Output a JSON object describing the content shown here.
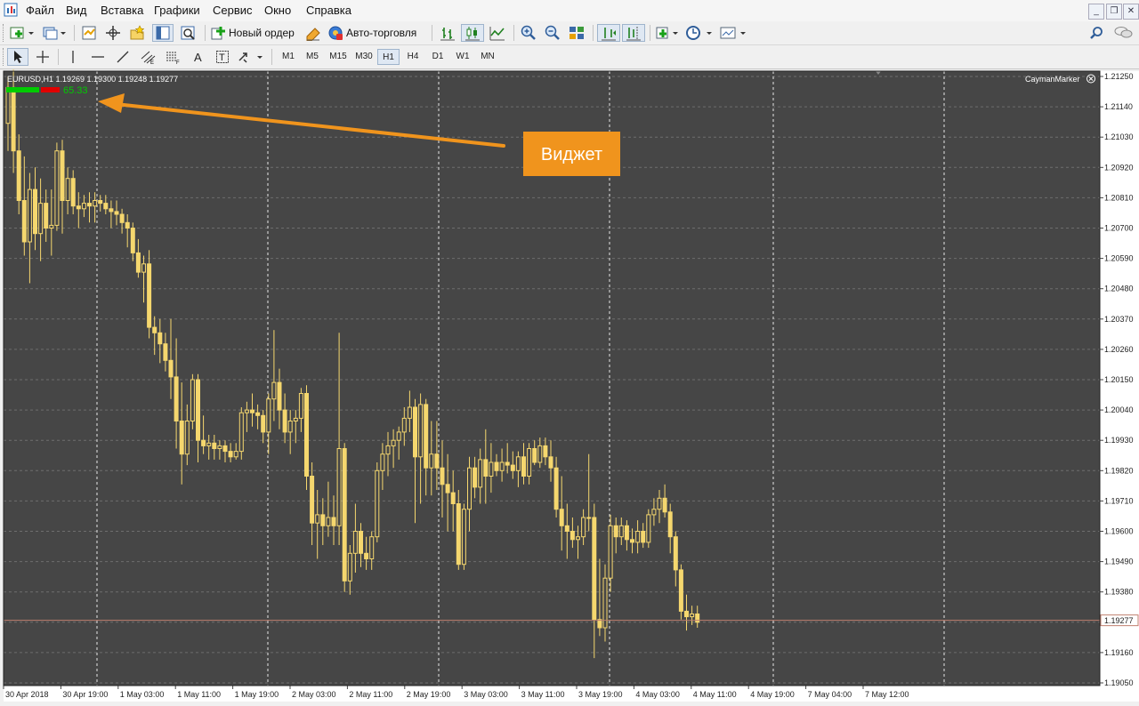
{
  "menu": {
    "items": [
      "Файл",
      "Вид",
      "Вставка",
      "Графики",
      "Сервис",
      "Окно",
      "Справка"
    ]
  },
  "toolbar": {
    "new_order_label": "Новый ордер",
    "auto_trading_label": "Авто-торговля"
  },
  "timeframes": [
    "M1",
    "M5",
    "M15",
    "M30",
    "H1",
    "H4",
    "D1",
    "W1",
    "MN"
  ],
  "active_timeframe": "H1",
  "chart": {
    "header": "EURUSD,H1  1.19269 1.19300 1.19248 1.19277",
    "indicator_name": "CaymanMarker",
    "widget_value": "65.33",
    "annotation": "Виджет",
    "current_price_label": "1.19277",
    "colors": {
      "background": "#464646",
      "candle": "#f5d76e",
      "grid": "#6e6e6e",
      "annotation": "#f0941d",
      "price_line": "#c08070",
      "widget_green": "#00cc00",
      "widget_red": "#e00000"
    }
  },
  "chart_data": {
    "type": "candlestick",
    "symbol": "EURUSD",
    "timeframe": "H1",
    "y_ticks": [
      "1.21250",
      "1.21140",
      "1.21030",
      "1.20920",
      "1.20810",
      "1.20700",
      "1.20590",
      "1.20480",
      "1.20370",
      "1.20260",
      "1.20150",
      "1.20040",
      "1.19930",
      "1.19820",
      "1.19710",
      "1.19600",
      "1.19490",
      "1.19380",
      "1.19270",
      "1.19160",
      "1.19050"
    ],
    "x_ticks": [
      "30 Apr 2018",
      "30 Apr 19:00",
      "1 May 03:00",
      "1 May 11:00",
      "1 May 19:00",
      "2 May 03:00",
      "2 May 11:00",
      "2 May 19:00",
      "3 May 03:00",
      "3 May 11:00",
      "3 May 19:00",
      "4 May 03:00",
      "4 May 11:00",
      "4 May 19:00",
      "7 May 04:00",
      "7 May 12:00"
    ],
    "ylim": [
      1.1905,
      1.2125
    ],
    "last_price": 1.19277,
    "candles": [
      [
        1.2108,
        1.2125,
        1.2098,
        1.2121
      ],
      [
        1.2121,
        1.2128,
        1.209,
        1.2098
      ],
      [
        1.2098,
        1.2104,
        1.2075,
        1.208
      ],
      [
        1.208,
        1.2096,
        1.206,
        1.2065
      ],
      [
        1.2065,
        1.209,
        1.205,
        1.2084
      ],
      [
        1.2084,
        1.2092,
        1.2062,
        1.2068
      ],
      [
        1.2068,
        1.2088,
        1.2058,
        1.2079
      ],
      [
        1.2079,
        1.2084,
        1.2065,
        1.207
      ],
      [
        1.207,
        1.2084,
        1.206,
        1.2071
      ],
      [
        1.2071,
        1.2101,
        1.2069,
        1.2098
      ],
      [
        1.2098,
        1.2102,
        1.2068,
        1.208
      ],
      [
        1.208,
        1.2092,
        1.2075,
        1.2088
      ],
      [
        1.2088,
        1.2091,
        1.2075,
        1.2078
      ],
      [
        1.2078,
        1.2083,
        1.207,
        1.2077
      ],
      [
        1.2077,
        1.2082,
        1.2074,
        1.2079
      ],
      [
        1.2079,
        1.2083,
        1.2072,
        1.2078
      ],
      [
        1.2078,
        1.2083,
        1.2072,
        1.208
      ],
      [
        1.208,
        1.2082,
        1.2076,
        1.2079
      ],
      [
        1.2079,
        1.2082,
        1.2075,
        1.2077
      ],
      [
        1.2077,
        1.208,
        1.207,
        1.2076
      ],
      [
        1.2076,
        1.208,
        1.2071,
        1.2075
      ],
      [
        1.2075,
        1.2077,
        1.2068,
        1.2072
      ],
      [
        1.2072,
        1.2075,
        1.2063,
        1.207
      ],
      [
        1.207,
        1.2072,
        1.2058,
        1.2061
      ],
      [
        1.2061,
        1.2066,
        1.2052,
        1.2054
      ],
      [
        1.2054,
        1.206,
        1.2043,
        1.2057
      ],
      [
        1.2057,
        1.2062,
        1.203,
        1.2034
      ],
      [
        1.2034,
        1.2038,
        1.2024,
        1.2032
      ],
      [
        1.2032,
        1.2037,
        1.2021,
        1.2028
      ],
      [
        1.2028,
        1.2032,
        1.2018,
        1.2022
      ],
      [
        1.2022,
        1.2037,
        1.2008,
        1.2016
      ],
      [
        1.2016,
        1.203,
        1.199,
        1.2
      ],
      [
        1.2,
        1.2014,
        1.1977,
        1.1988
      ],
      [
        1.1988,
        1.2006,
        1.1984,
        1.2
      ],
      [
        1.2,
        1.2017,
        1.1997,
        1.2015
      ],
      [
        1.2015,
        1.2017,
        1.1985,
        1.1993
      ],
      [
        1.1993,
        1.2002,
        1.1988,
        1.1991
      ],
      [
        1.1991,
        1.1995,
        1.1986,
        1.1992
      ],
      [
        1.1992,
        1.1995,
        1.1986,
        1.199
      ],
      [
        1.199,
        1.1993,
        1.1986,
        1.1991
      ],
      [
        1.1991,
        1.1993,
        1.1985,
        1.1989
      ],
      [
        1.1989,
        1.1992,
        1.1985,
        1.1987
      ],
      [
        1.1987,
        1.1992,
        1.1986,
        1.1989
      ],
      [
        1.1989,
        1.2005,
        1.1986,
        1.2003
      ],
      [
        1.2003,
        1.2007,
        1.1996,
        1.2004
      ],
      [
        1.2004,
        1.201,
        1.1998,
        1.2003
      ],
      [
        1.2003,
        1.2006,
        1.1997,
        1.2002
      ],
      [
        1.2002,
        1.2004,
        1.1992,
        1.1996
      ],
      [
        1.1996,
        1.201,
        1.1988,
        1.2008
      ],
      [
        1.2008,
        1.2033,
        1.2,
        1.2014
      ],
      [
        1.2014,
        1.2019,
        1.1997,
        1.2004
      ],
      [
        1.2004,
        1.201,
        1.1992,
        1.1996
      ],
      [
        1.1996,
        1.2004,
        1.1988,
        1.2
      ],
      [
        1.2,
        1.2004,
        1.1992,
        1.2001
      ],
      [
        1.2001,
        1.2012,
        1.1996,
        1.201
      ],
      [
        1.201,
        1.2013,
        1.1975,
        1.198
      ],
      [
        1.198,
        1.1985,
        1.1955,
        1.1963
      ],
      [
        1.1963,
        1.1975,
        1.195,
        1.1966
      ],
      [
        1.1966,
        1.1972,
        1.1955,
        1.1962
      ],
      [
        1.1962,
        1.1978,
        1.1958,
        1.1965
      ],
      [
        1.1965,
        1.1973,
        1.1955,
        1.1962
      ],
      [
        1.1962,
        1.2032,
        1.1955,
        1.199
      ],
      [
        1.199,
        1.1992,
        1.1938,
        1.1942
      ],
      [
        1.1942,
        1.1955,
        1.1937,
        1.1952
      ],
      [
        1.1952,
        1.197,
        1.1945,
        1.196
      ],
      [
        1.196,
        1.1963,
        1.1947,
        1.1952
      ],
      [
        1.1952,
        1.1958,
        1.1946,
        1.195
      ],
      [
        1.195,
        1.196,
        1.1946,
        1.1958
      ],
      [
        1.1958,
        1.1985,
        1.1956,
        1.1982
      ],
      [
        1.1982,
        1.1992,
        1.1975,
        1.1988
      ],
      [
        1.1988,
        1.1996,
        1.198,
        1.1991
      ],
      [
        1.1991,
        1.1997,
        1.1983,
        1.1993
      ],
      [
        1.1993,
        1.1998,
        1.1986,
        1.1996
      ],
      [
        1.1996,
        1.2005,
        1.1991,
        1.2001
      ],
      [
        1.2001,
        1.2011,
        1.1996,
        1.2005
      ],
      [
        1.2005,
        1.2008,
        1.1963,
        1.1987
      ],
      [
        1.1987,
        1.201,
        1.197,
        1.2006
      ],
      [
        1.2006,
        1.2008,
        1.1973,
        1.1983
      ],
      [
        1.1983,
        1.2,
        1.1973,
        1.1988
      ],
      [
        1.1988,
        1.2,
        1.1975,
        1.1983
      ],
      [
        1.1983,
        1.1993,
        1.1965,
        1.1977
      ],
      [
        1.1977,
        1.1988,
        1.196,
        1.1974
      ],
      [
        1.1974,
        1.1982,
        1.196,
        1.197
      ],
      [
        1.197,
        1.1975,
        1.1946,
        1.1948
      ],
      [
        1.1948,
        1.197,
        1.1946,
        1.1968
      ],
      [
        1.1968,
        1.1987,
        1.196,
        1.1983
      ],
      [
        1.1983,
        1.1987,
        1.1972,
        1.1976
      ],
      [
        1.1976,
        1.199,
        1.197,
        1.1986
      ],
      [
        1.1986,
        1.1997,
        1.197,
        1.198
      ],
      [
        1.198,
        1.1992,
        1.1974,
        1.1985
      ],
      [
        1.1985,
        1.1988,
        1.198,
        1.1982
      ],
      [
        1.1982,
        1.199,
        1.1978,
        1.1985
      ],
      [
        1.1985,
        1.1992,
        1.1981,
        1.1984
      ],
      [
        1.1984,
        1.1989,
        1.1979,
        1.1982
      ],
      [
        1.1982,
        1.1989,
        1.1976,
        1.1987
      ],
      [
        1.1987,
        1.1992,
        1.1977,
        1.198
      ],
      [
        1.198,
        1.1992,
        1.1977,
        1.199
      ],
      [
        1.199,
        1.1993,
        1.1984,
        1.1985
      ],
      [
        1.1985,
        1.1994,
        1.1983,
        1.1991
      ],
      [
        1.1991,
        1.1994,
        1.1984,
        1.1987
      ],
      [
        1.1987,
        1.1993,
        1.1978,
        1.1983
      ],
      [
        1.1983,
        1.1987,
        1.1965,
        1.1968
      ],
      [
        1.1968,
        1.198,
        1.1953,
        1.1962
      ],
      [
        1.1962,
        1.197,
        1.195,
        1.196
      ],
      [
        1.196,
        1.1965,
        1.1954,
        1.1957
      ],
      [
        1.1957,
        1.1962,
        1.195,
        1.1958
      ],
      [
        1.1958,
        1.1968,
        1.1955,
        1.1965
      ],
      [
        1.1965,
        1.1988,
        1.196,
        1.1965
      ],
      [
        1.1965,
        1.197,
        1.1914,
        1.1928
      ],
      [
        1.1928,
        1.195,
        1.1922,
        1.1925
      ],
      [
        1.1925,
        1.1948,
        1.192,
        1.1943
      ],
      [
        1.1943,
        1.1966,
        1.1938,
        1.1962
      ],
      [
        1.1962,
        1.1965,
        1.1952,
        1.1958
      ],
      [
        1.1958,
        1.1965,
        1.1955,
        1.1962
      ],
      [
        1.1962,
        1.1964,
        1.1953,
        1.1957
      ],
      [
        1.1957,
        1.1961,
        1.1952,
        1.1956
      ],
      [
        1.1956,
        1.1964,
        1.1952,
        1.196
      ],
      [
        1.196,
        1.1963,
        1.1954,
        1.1956
      ],
      [
        1.1956,
        1.1968,
        1.1954,
        1.1966
      ],
      [
        1.1966,
        1.1972,
        1.1962,
        1.1968
      ],
      [
        1.1968,
        1.1975,
        1.1963,
        1.1972
      ],
      [
        1.1972,
        1.1977,
        1.1965,
        1.1967
      ],
      [
        1.1967,
        1.197,
        1.1952,
        1.1958
      ],
      [
        1.1958,
        1.196,
        1.194,
        1.1946
      ],
      [
        1.1946,
        1.1948,
        1.1928,
        1.1931
      ],
      [
        1.1931,
        1.1937,
        1.1924,
        1.1929
      ],
      [
        1.1929,
        1.1933,
        1.1926,
        1.193
      ],
      [
        1.193,
        1.1933,
        1.1925,
        1.1927
      ]
    ]
  }
}
